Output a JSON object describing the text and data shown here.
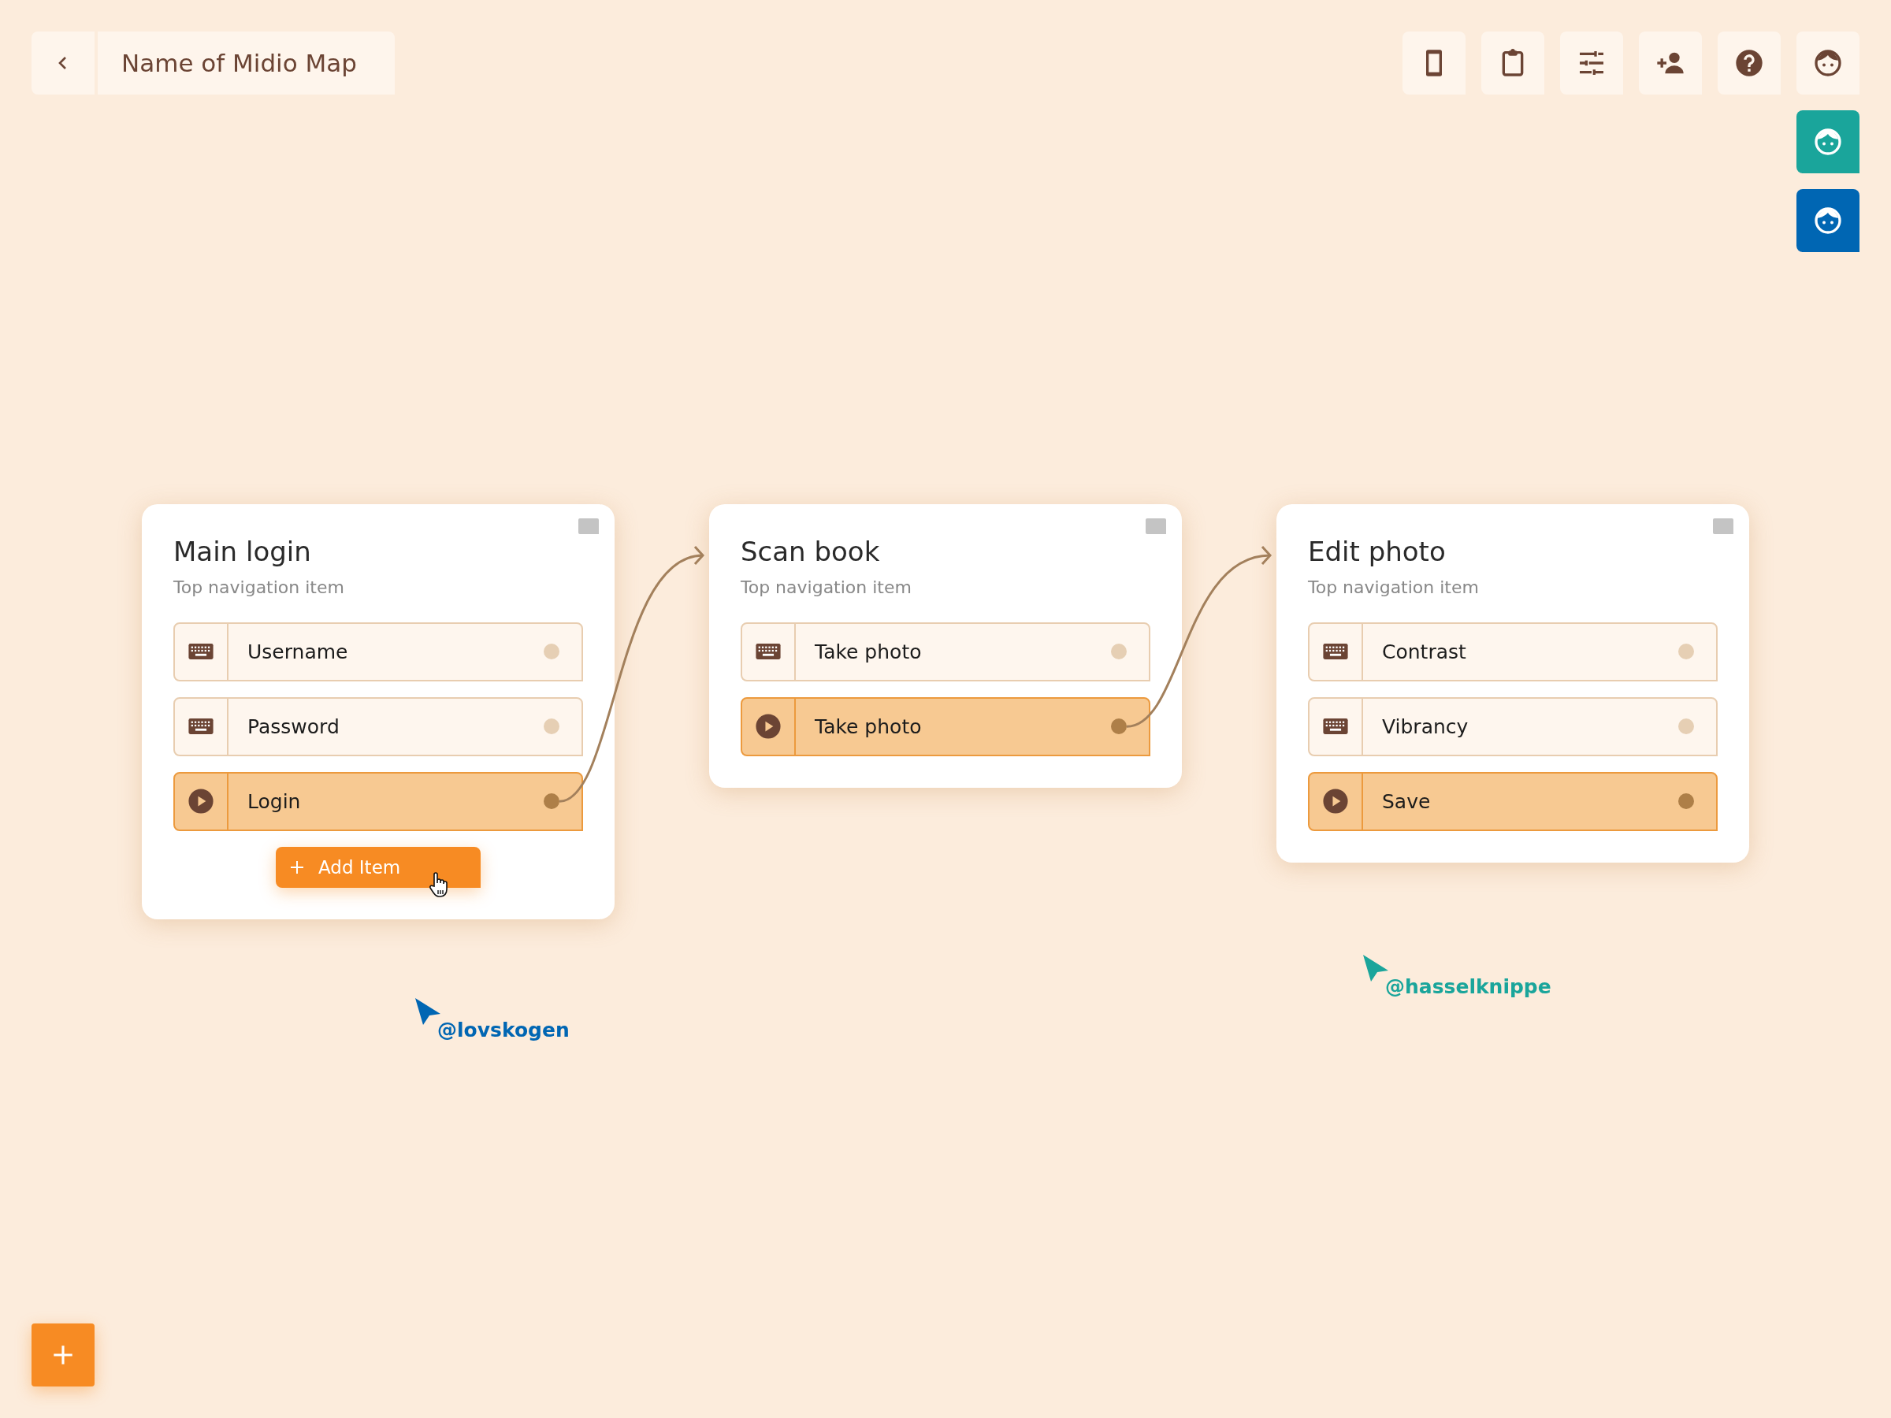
{
  "header": {
    "title": "Name of Midio Map"
  },
  "collaborators": [
    {
      "color": "#1aa59b"
    },
    {
      "color": "#0066b3"
    }
  ],
  "cards": [
    {
      "title": "Main login",
      "subtitle": "Top navigation item",
      "add_button": "Add Item",
      "items": [
        {
          "kind": "input",
          "label": "Username"
        },
        {
          "kind": "input",
          "label": "Password"
        },
        {
          "kind": "action",
          "label": "Login"
        }
      ]
    },
    {
      "title": "Scan book",
      "subtitle": "Top navigation item",
      "items": [
        {
          "kind": "input",
          "label": "Take photo"
        },
        {
          "kind": "action",
          "label": "Take photo"
        }
      ]
    },
    {
      "title": "Edit photo",
      "subtitle": "Top navigation item",
      "items": [
        {
          "kind": "input",
          "label": "Contrast"
        },
        {
          "kind": "input",
          "label": "Vibrancy"
        },
        {
          "kind": "action",
          "label": "Save"
        }
      ]
    }
  ],
  "cursors": [
    {
      "handle": "@lovskogen",
      "color": "#0066b3"
    },
    {
      "handle": "@hasselknippe",
      "color": "#1aa59b"
    }
  ]
}
